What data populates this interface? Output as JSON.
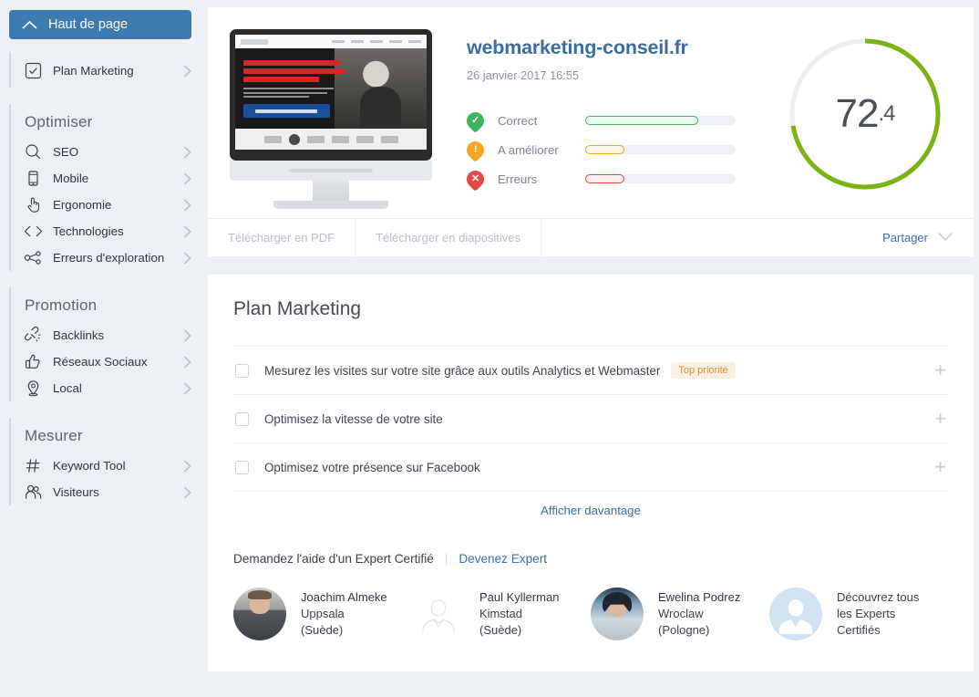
{
  "sidebar": {
    "active_item": {
      "label": "Haut de page",
      "icon": "chevron-up-icon"
    },
    "plan_item": {
      "label": "Plan Marketing",
      "icon": "checkbox-check-icon"
    },
    "groups": [
      {
        "title": "Optimiser",
        "items": [
          {
            "label": "SEO",
            "icon": "search-icon"
          },
          {
            "label": "Mobile",
            "icon": "mobile-icon"
          },
          {
            "label": "Ergonomie",
            "icon": "hand-pointer-icon"
          },
          {
            "label": "Technologies",
            "icon": "code-brackets-icon"
          },
          {
            "label": "Erreurs d'exploration",
            "icon": "sitemap-icon"
          }
        ]
      },
      {
        "title": "Promotion",
        "items": [
          {
            "label": "Backlinks",
            "icon": "broken-link-icon"
          },
          {
            "label": "Réseaux Sociaux",
            "icon": "thumbs-up-icon"
          },
          {
            "label": "Local",
            "icon": "map-pin-icon"
          }
        ]
      },
      {
        "title": "Mesurer",
        "items": [
          {
            "label": "Keyword Tool",
            "icon": "hash-icon"
          },
          {
            "label": "Visiteurs",
            "icon": "users-icon"
          }
        ]
      }
    ]
  },
  "header": {
    "site_title": "webmarketing-conseil.fr",
    "scan_date": "26 janvier 2017 16:55",
    "legend": [
      {
        "label": "Correct",
        "icon": "check-badge-icon",
        "color": "#40b560",
        "fill": "#eaf7ed",
        "percent": 75
      },
      {
        "label": "A améliorer",
        "icon": "warning-badge-icon",
        "color": "#f5a623",
        "fill": "#fef6e8",
        "percent": 26
      },
      {
        "label": "Erreurs",
        "icon": "error-badge-icon",
        "color": "#e04a45",
        "fill": "#fdeeed",
        "percent": 26
      }
    ],
    "score": {
      "value": "72",
      "decimal": ".4",
      "percent": 72.4,
      "color": "#7cb313",
      "track": "#eceef1"
    },
    "thumbnail": {
      "alt": "webmarketing-conseil.fr homepage on desktop monitor",
      "headline": "Je suis passé de 0 à 215 000 visiteurs B2B par mois en 2 ans",
      "cta": "Accéder à mes Méthodes"
    }
  },
  "toolbar": {
    "pdf_label": "Télécharger en PDF",
    "slides_label": "Télécharger en diapositives",
    "share_label": "Partager",
    "share_icon": "chevron-down-icon"
  },
  "plan": {
    "title": "Plan Marketing",
    "tasks": [
      {
        "label": "Mesurez les visites sur votre site grâce aux outils Analytics et Webmaster",
        "badge": "Top priorité"
      },
      {
        "label": "Optimisez la vitesse de votre site",
        "badge": ""
      },
      {
        "label": "Optimisez votre présence sur Facebook",
        "badge": ""
      }
    ],
    "more_label": "Afficher davantage"
  },
  "experts": {
    "heading": "Demandez l'aide d'un Expert Certifié",
    "become_link": "Devenez Expert",
    "people": [
      {
        "name": "Joachim Almeke",
        "city": "Uppsala",
        "country": "(Suède)",
        "avatar": "photo"
      },
      {
        "name": "Paul Kyllerman",
        "city": "Kimstad",
        "country": "(Suède)",
        "avatar": "placeholder-outline"
      },
      {
        "name": "Ewelina Podrez",
        "city": "Wroclaw",
        "country": "(Pologne)",
        "avatar": "photo"
      }
    ],
    "discover": {
      "line1": "Découvrez tous",
      "line2": "les Experts",
      "line3": "Certifiés",
      "avatar": "placeholder-filled"
    }
  }
}
